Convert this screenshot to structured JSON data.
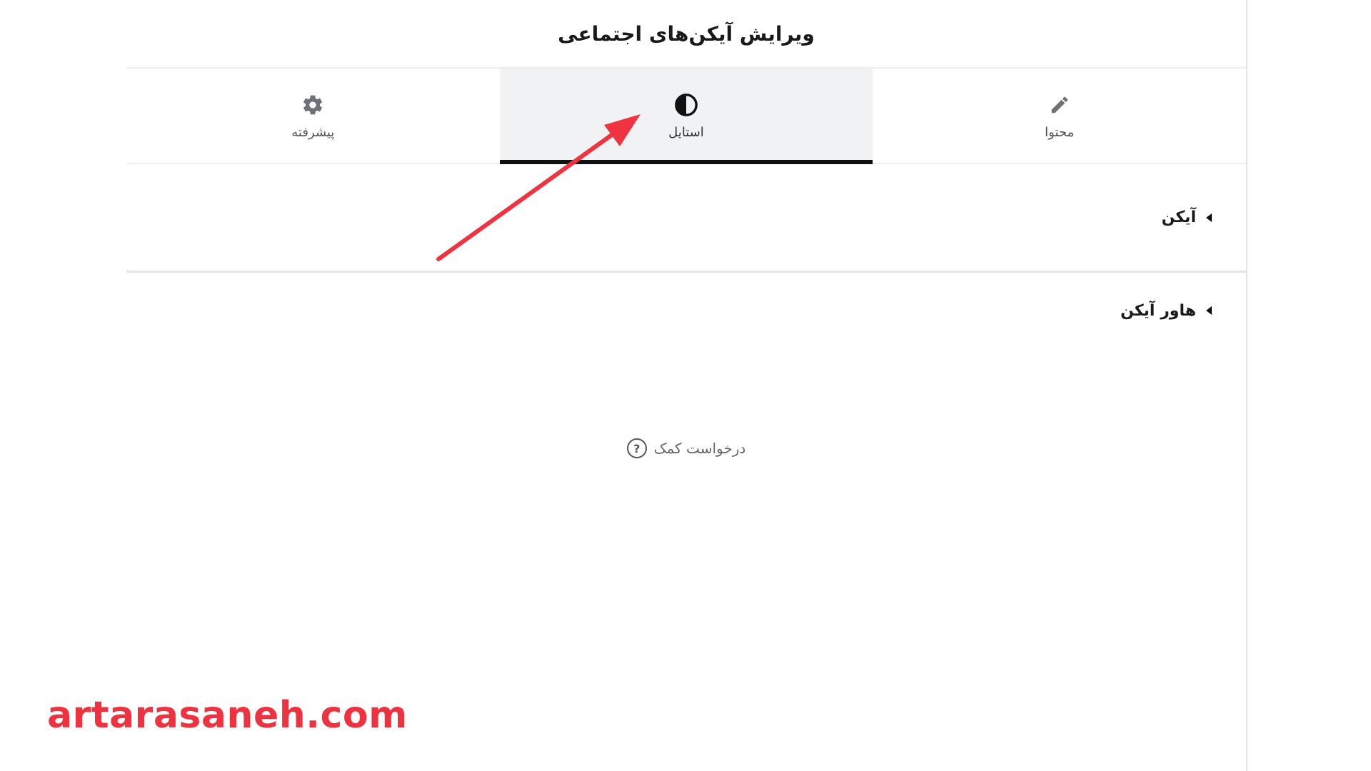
{
  "panel": {
    "title": "ویرایش آیکن‌های اجتماعی"
  },
  "tabs": [
    {
      "label": "محتوا",
      "icon": "pencil-icon",
      "active": false
    },
    {
      "label": "استایل",
      "icon": "contrast-icon",
      "active": true
    },
    {
      "label": "پیشرفته",
      "icon": "gear-icon",
      "active": false
    }
  ],
  "sections": [
    {
      "label": "آیکن",
      "icon": "caret-left-icon"
    },
    {
      "label": "هاور آیکن",
      "icon": "caret-left-icon"
    }
  ],
  "help": {
    "label": "درخواست کمک",
    "icon": "question-circle-icon",
    "glyph": "?"
  },
  "annotation": {
    "arrow_color": "#ef3340"
  },
  "watermark": {
    "text": "artarasaneh.com",
    "color": "#ee3340"
  },
  "colors": {
    "active_tab_bg": "#f1f2f3",
    "active_tab_indicator": "#111111",
    "divider": "#eceef0"
  }
}
